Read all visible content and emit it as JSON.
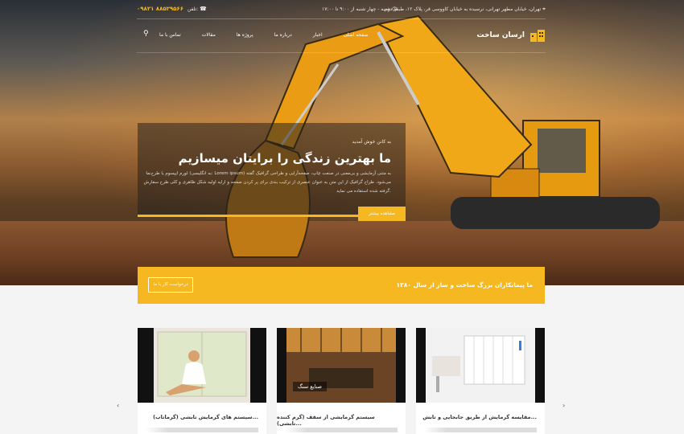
{
  "topbar": {
    "phone_number": "۰۹۸۲۱ ۸۸۵۲۹۵۶۶",
    "phone_label": "تلفن:",
    "date": "شنبه - چهار شنبه از ۹:۰۰ تا ۱۷:۰۰",
    "address": "تهران، خیابان مطهر تهرانی، نرسیده به خیابان کاووسی فر، پلاک ۱۲، طبقه دوم"
  },
  "nav": {
    "menu": [
      "تماس با ما",
      "مقالات",
      "پروژه ها",
      "درباره ما",
      "اخبار",
      "صفحه اصلی"
    ],
    "logo": "ارسان ساخت"
  },
  "slide": {
    "welcome": "به کانن خوش آمدید",
    "headline": "ما بهترین زندگی را برایتان میسازیم",
    "description": "لورم ایپسوم یا طرح‌نما (به انگلیسی: Lorem ipsum) به متنی آزمایشی و بی‌معنی در صنعت چاپ، صفحه‌آرایی و طراحی گرافیک گفته می‌شود. طراح گرافیک از این متن به عنوان عنصری از ترکیب بندی برای پر کردن صفحه و ارایه اولیه شکل ظاهری و کلی طرح سفارش گرفته شده استفاده می نماید.",
    "button": "مشاهده بیشتر"
  },
  "banner": {
    "text": "ما پیمانکاران بزرگ ساخت و ساز از سال ۱۳۸۰",
    "button": "درخواست کار با ما"
  },
  "cards": [
    {
      "title": "مقایسه گرمایش از طریق جابجایی و تابش...",
      "image": "radiator"
    },
    {
      "title": "سیستم گرمایشی از سقف (گرم کننده تابشی)...",
      "image": "factory",
      "label": "صنایع سنگ"
    },
    {
      "title": "سیستم های گرمایش تابشی (گرماتاب)...",
      "image": "woman-window"
    }
  ],
  "colors": {
    "accent": "#f5b820"
  }
}
